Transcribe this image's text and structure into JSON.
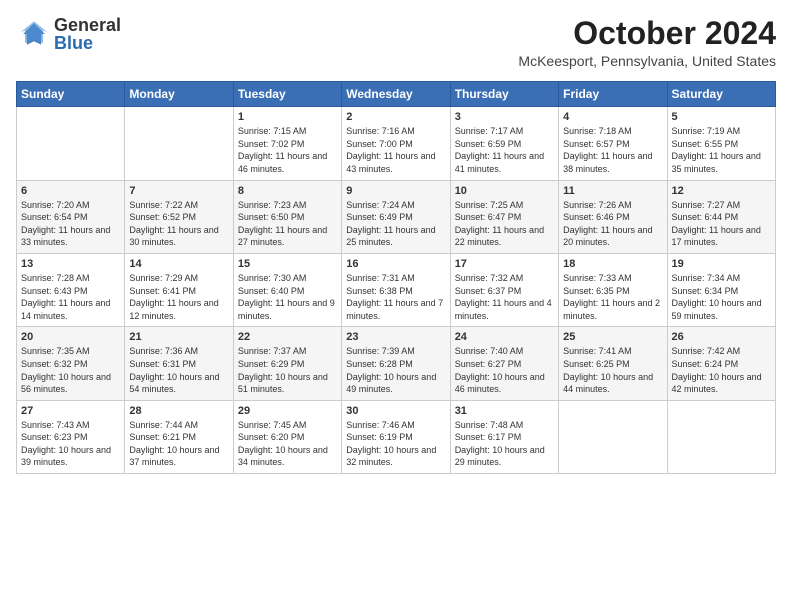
{
  "header": {
    "logo_general": "General",
    "logo_blue": "Blue",
    "month": "October 2024",
    "location": "McKeesport, Pennsylvania, United States"
  },
  "days_of_week": [
    "Sunday",
    "Monday",
    "Tuesday",
    "Wednesday",
    "Thursday",
    "Friday",
    "Saturday"
  ],
  "weeks": [
    [
      {
        "day": "",
        "content": ""
      },
      {
        "day": "",
        "content": ""
      },
      {
        "day": "1",
        "content": "Sunrise: 7:15 AM\nSunset: 7:02 PM\nDaylight: 11 hours and 46 minutes."
      },
      {
        "day": "2",
        "content": "Sunrise: 7:16 AM\nSunset: 7:00 PM\nDaylight: 11 hours and 43 minutes."
      },
      {
        "day": "3",
        "content": "Sunrise: 7:17 AM\nSunset: 6:59 PM\nDaylight: 11 hours and 41 minutes."
      },
      {
        "day": "4",
        "content": "Sunrise: 7:18 AM\nSunset: 6:57 PM\nDaylight: 11 hours and 38 minutes."
      },
      {
        "day": "5",
        "content": "Sunrise: 7:19 AM\nSunset: 6:55 PM\nDaylight: 11 hours and 35 minutes."
      }
    ],
    [
      {
        "day": "6",
        "content": "Sunrise: 7:20 AM\nSunset: 6:54 PM\nDaylight: 11 hours and 33 minutes."
      },
      {
        "day": "7",
        "content": "Sunrise: 7:22 AM\nSunset: 6:52 PM\nDaylight: 11 hours and 30 minutes."
      },
      {
        "day": "8",
        "content": "Sunrise: 7:23 AM\nSunset: 6:50 PM\nDaylight: 11 hours and 27 minutes."
      },
      {
        "day": "9",
        "content": "Sunrise: 7:24 AM\nSunset: 6:49 PM\nDaylight: 11 hours and 25 minutes."
      },
      {
        "day": "10",
        "content": "Sunrise: 7:25 AM\nSunset: 6:47 PM\nDaylight: 11 hours and 22 minutes."
      },
      {
        "day": "11",
        "content": "Sunrise: 7:26 AM\nSunset: 6:46 PM\nDaylight: 11 hours and 20 minutes."
      },
      {
        "day": "12",
        "content": "Sunrise: 7:27 AM\nSunset: 6:44 PM\nDaylight: 11 hours and 17 minutes."
      }
    ],
    [
      {
        "day": "13",
        "content": "Sunrise: 7:28 AM\nSunset: 6:43 PM\nDaylight: 11 hours and 14 minutes."
      },
      {
        "day": "14",
        "content": "Sunrise: 7:29 AM\nSunset: 6:41 PM\nDaylight: 11 hours and 12 minutes."
      },
      {
        "day": "15",
        "content": "Sunrise: 7:30 AM\nSunset: 6:40 PM\nDaylight: 11 hours and 9 minutes."
      },
      {
        "day": "16",
        "content": "Sunrise: 7:31 AM\nSunset: 6:38 PM\nDaylight: 11 hours and 7 minutes."
      },
      {
        "day": "17",
        "content": "Sunrise: 7:32 AM\nSunset: 6:37 PM\nDaylight: 11 hours and 4 minutes."
      },
      {
        "day": "18",
        "content": "Sunrise: 7:33 AM\nSunset: 6:35 PM\nDaylight: 11 hours and 2 minutes."
      },
      {
        "day": "19",
        "content": "Sunrise: 7:34 AM\nSunset: 6:34 PM\nDaylight: 10 hours and 59 minutes."
      }
    ],
    [
      {
        "day": "20",
        "content": "Sunrise: 7:35 AM\nSunset: 6:32 PM\nDaylight: 10 hours and 56 minutes."
      },
      {
        "day": "21",
        "content": "Sunrise: 7:36 AM\nSunset: 6:31 PM\nDaylight: 10 hours and 54 minutes."
      },
      {
        "day": "22",
        "content": "Sunrise: 7:37 AM\nSunset: 6:29 PM\nDaylight: 10 hours and 51 minutes."
      },
      {
        "day": "23",
        "content": "Sunrise: 7:39 AM\nSunset: 6:28 PM\nDaylight: 10 hours and 49 minutes."
      },
      {
        "day": "24",
        "content": "Sunrise: 7:40 AM\nSunset: 6:27 PM\nDaylight: 10 hours and 46 minutes."
      },
      {
        "day": "25",
        "content": "Sunrise: 7:41 AM\nSunset: 6:25 PM\nDaylight: 10 hours and 44 minutes."
      },
      {
        "day": "26",
        "content": "Sunrise: 7:42 AM\nSunset: 6:24 PM\nDaylight: 10 hours and 42 minutes."
      }
    ],
    [
      {
        "day": "27",
        "content": "Sunrise: 7:43 AM\nSunset: 6:23 PM\nDaylight: 10 hours and 39 minutes."
      },
      {
        "day": "28",
        "content": "Sunrise: 7:44 AM\nSunset: 6:21 PM\nDaylight: 10 hours and 37 minutes."
      },
      {
        "day": "29",
        "content": "Sunrise: 7:45 AM\nSunset: 6:20 PM\nDaylight: 10 hours and 34 minutes."
      },
      {
        "day": "30",
        "content": "Sunrise: 7:46 AM\nSunset: 6:19 PM\nDaylight: 10 hours and 32 minutes."
      },
      {
        "day": "31",
        "content": "Sunrise: 7:48 AM\nSunset: 6:17 PM\nDaylight: 10 hours and 29 minutes."
      },
      {
        "day": "",
        "content": ""
      },
      {
        "day": "",
        "content": ""
      }
    ]
  ]
}
